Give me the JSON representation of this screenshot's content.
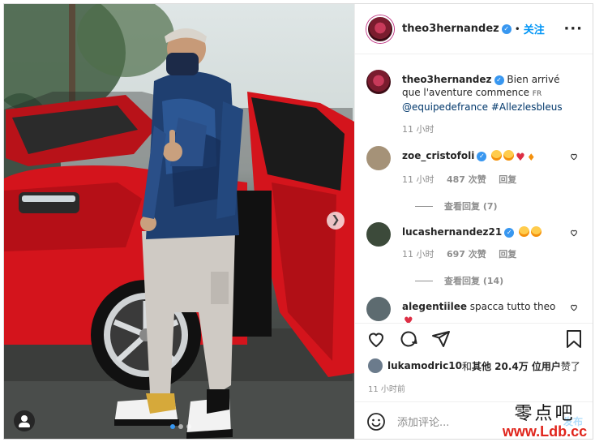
{
  "post": {
    "photo_alt": "",
    "carousel": {
      "count": 3,
      "active": 0
    }
  },
  "header": {
    "username": "theo3hernandez",
    "separator": "•",
    "follow_label": "关注",
    "more_label": "···"
  },
  "caption": {
    "username": "theo3hernandez",
    "text_prefix": " Bien arrivé que l'aventure commence ",
    "flag_text": "FR",
    "mention": "@equipedefrance",
    "hashtag": " #Allezlesbleus",
    "time": "11 小时"
  },
  "comments": [
    {
      "username": "zoe_cristofoli",
      "time": "11 小时",
      "likes": "487 次赞",
      "reply": "回复",
      "view_replies": "查看回复 (7)"
    },
    {
      "username": "lucashernandez21",
      "time": "11 小时",
      "likes": "697 次赞",
      "reply": "回复",
      "view_replies": "查看回复 (14)"
    },
    {
      "username": "alegentiilee",
      "text": " spacca tutto theo"
    }
  ],
  "likes": {
    "user": "lukamodric10",
    "and": " 和 ",
    "others": "其他 20.4万 位用户",
    "suffix": " 赞了"
  },
  "post_time": "11 小时前",
  "composer": {
    "placeholder": "添加评论...",
    "post_label": "发布"
  },
  "watermark": {
    "cn": "零点吧",
    "url": "www.Ldb.cc"
  },
  "colors": {
    "accent": "#0095f6",
    "verified": "#3897f0",
    "car_red": "#d4141c",
    "watermark_red": "#e0241b"
  },
  "icons": [
    "tag-people-icon",
    "next-arrow-icon",
    "more-icon",
    "heart-icon",
    "comment-icon",
    "share-icon",
    "save-icon",
    "emoji-icon",
    "verified-icon"
  ]
}
